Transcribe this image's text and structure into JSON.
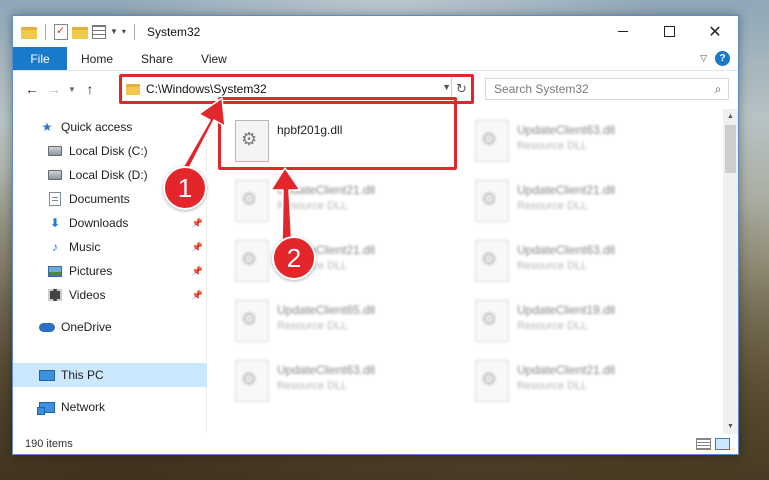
{
  "window": {
    "title": "System32"
  },
  "ribbon": {
    "tabs": [
      "File",
      "Home",
      "Share",
      "View"
    ]
  },
  "address": {
    "path": "C:\\Windows\\System32"
  },
  "search": {
    "placeholder": "Search System32"
  },
  "sidebar": {
    "items": [
      {
        "label": "Quick access",
        "icon": "star-icon"
      },
      {
        "label": "Local Disk (C:)",
        "icon": "disk-icon"
      },
      {
        "label": "Local Disk (D:)",
        "icon": "disk-icon"
      },
      {
        "label": "Documents",
        "icon": "documents-icon"
      },
      {
        "label": "Downloads",
        "icon": "download-icon",
        "pinned": true
      },
      {
        "label": "Music",
        "icon": "music-icon",
        "pinned": true
      },
      {
        "label": "Pictures",
        "icon": "pictures-icon",
        "pinned": true
      },
      {
        "label": "Videos",
        "icon": "videos-icon",
        "pinned": true
      },
      {
        "label": "OneDrive",
        "icon": "cloud-icon"
      },
      {
        "label": "This PC",
        "icon": "computer-icon",
        "selected": true
      },
      {
        "label": "Network",
        "icon": "network-icon"
      }
    ]
  },
  "files": [
    {
      "name": "hpbf201g.dll",
      "type": ""
    },
    {
      "name": "UpdateClient63.dll",
      "type": "Resource DLL"
    },
    {
      "name": "UpdateClient21.dll",
      "type": "Resource DLL"
    },
    {
      "name": "UpdateClient21.dll",
      "type": "Resource DLL"
    },
    {
      "name": "UpdateClient21.dll",
      "type": "Resource DLL"
    },
    {
      "name": "UpdateClient63.dll",
      "type": "Resource DLL"
    },
    {
      "name": "UpdateClient65.dll",
      "type": "Resource DLL"
    },
    {
      "name": "UpdateClient19.dll",
      "type": "Resource DLL"
    },
    {
      "name": "UpdateClient63.dll",
      "type": "Resource DLL"
    },
    {
      "name": "UpdateClient21.dll",
      "type": "Resource DLL"
    }
  ],
  "status": {
    "item_count": "190 items"
  },
  "annotations": {
    "step1": "1",
    "step2": "2"
  },
  "colors": {
    "accent": "#1979ca",
    "highlight": "#e3262b",
    "selected": "#cce8ff"
  }
}
